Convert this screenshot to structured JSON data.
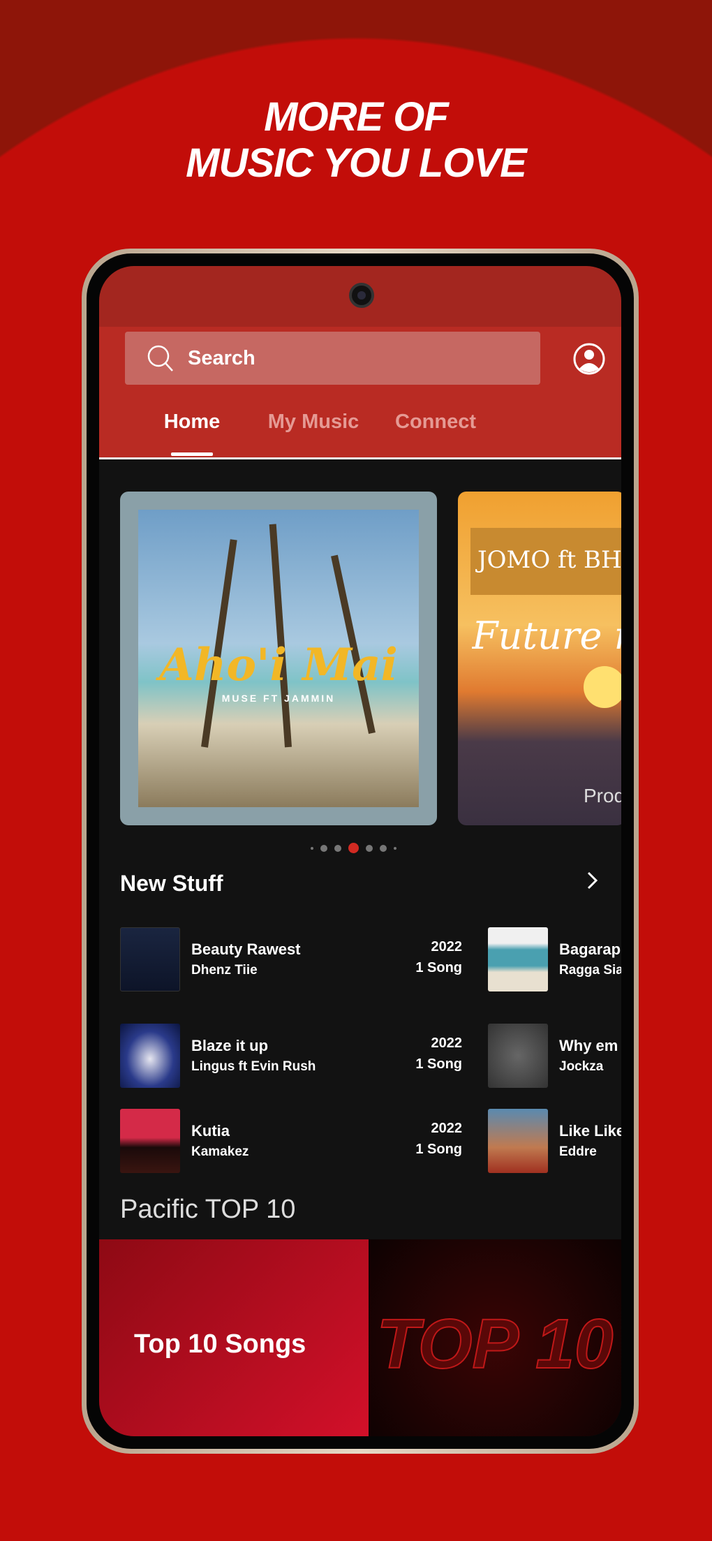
{
  "promo": {
    "line1": "MORE OF",
    "line2": "MUSIC YOU LOVE"
  },
  "header": {
    "search_placeholder": "Search",
    "profile_icon": "user-circle-icon",
    "search_icon": "magnifier-icon"
  },
  "tabs": [
    {
      "label": "Home",
      "active": true
    },
    {
      "label": "My Music",
      "active": false
    },
    {
      "label": "Connect",
      "active": false
    }
  ],
  "carousel": {
    "cards": [
      {
        "title": "Aho'i Mai",
        "subtitle": "MUSE FT JAMMIN"
      },
      {
        "title": "JOMO ft BHA",
        "subtitle": "Future na",
        "credit": "Prod"
      }
    ],
    "dots": 7,
    "active_dot": 3
  },
  "new_stuff": {
    "title": "New Stuff",
    "items": [
      {
        "title": "Beauty Rawest",
        "artist": "Dhenz Tiie",
        "year": "2022",
        "count": "1 Song"
      },
      {
        "title": "Blaze it up",
        "artist": "Lingus ft Evin Rush",
        "year": "2022",
        "count": "1 Song"
      },
      {
        "title": "Kutia",
        "artist": "Kamakez",
        "year": "2022",
        "count": "1 Song"
      },
      {
        "title": "Bagarapi",
        "artist": "Ragga Siai"
      },
      {
        "title": "Why em",
        "artist": "Jockza"
      },
      {
        "title": "Like Like",
        "artist": "Eddre"
      }
    ]
  },
  "pacific": {
    "title": "Pacific TOP 10",
    "banner_label": "Top 10 Songs",
    "banner_art": "TOP 10"
  },
  "colors": {
    "accent": "#b92b23",
    "background": "#121212",
    "promo_bg": "#c20d09"
  }
}
